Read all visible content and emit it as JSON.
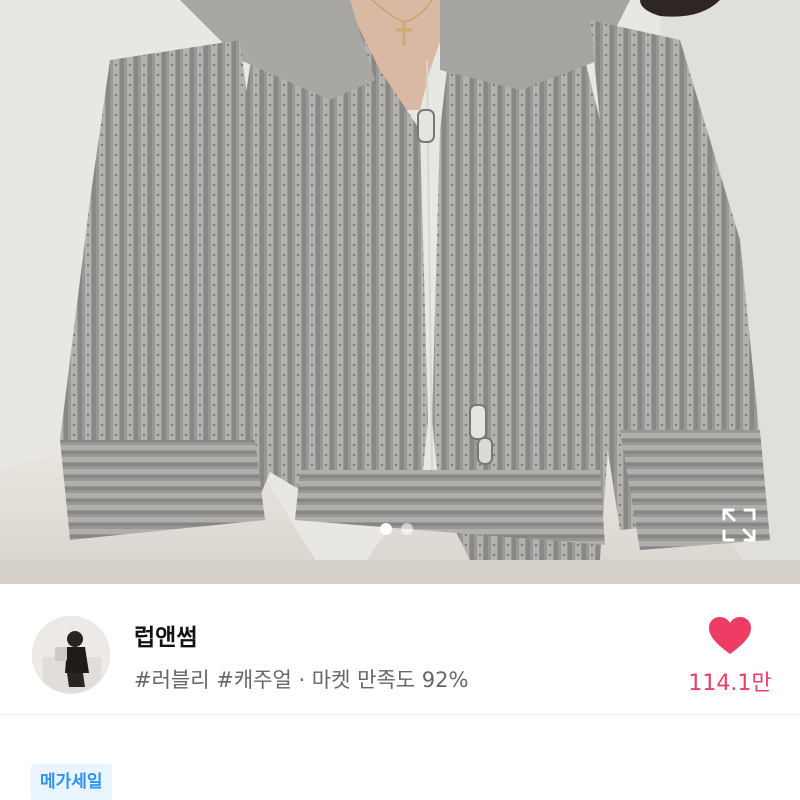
{
  "product_image": {
    "alt": "gray ribbed knit two-way zip cardigan",
    "carousel": {
      "total": 2,
      "active_index": 0
    },
    "expand_icon": "expand-icon"
  },
  "store": {
    "name": "럽앤썸",
    "tags": "#러블리 #캐주얼 · 마켓 만족도 92%",
    "like_icon": "heart-icon",
    "like_count": "114.1만",
    "accent_color": "#ee3d64"
  },
  "badge": {
    "label": "메가세일",
    "color": "#2b95f0",
    "background": "#e9f4fe"
  }
}
